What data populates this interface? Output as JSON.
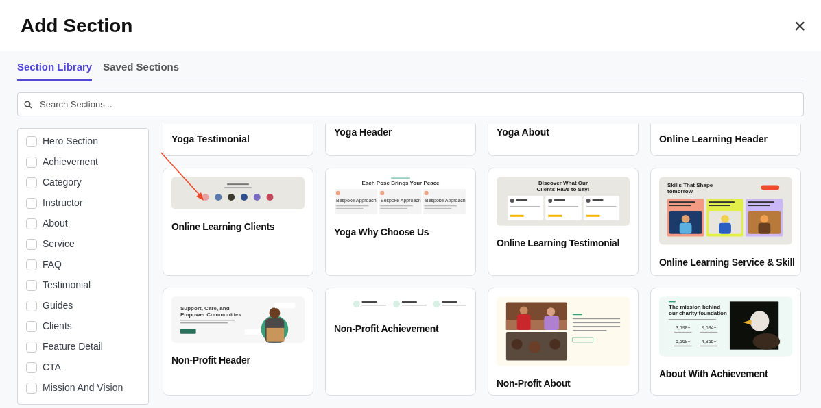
{
  "dialog": {
    "title": "Add Section",
    "close": "×"
  },
  "tabs": [
    {
      "label": "Section Library",
      "selected": true
    },
    {
      "label": "Saved Sections",
      "selected": false
    }
  ],
  "search": {
    "placeholder": "Search Sections..."
  },
  "filters": [
    {
      "label": "Hero Section",
      "checked": false
    },
    {
      "label": "Achievement",
      "checked": false
    },
    {
      "label": "Category",
      "checked": false
    },
    {
      "label": "Instructor",
      "checked": false
    },
    {
      "label": "About",
      "checked": false
    },
    {
      "label": "Service",
      "checked": false
    },
    {
      "label": "FAQ",
      "checked": false
    },
    {
      "label": "Testimonial",
      "checked": false
    },
    {
      "label": "Guides",
      "checked": false
    },
    {
      "label": "Clients",
      "checked": false
    },
    {
      "label": "Feature Detail",
      "checked": false
    },
    {
      "label": "CTA",
      "checked": false
    },
    {
      "label": "Mission And Vision",
      "checked": false
    }
  ],
  "partial_cards": [
    {
      "title": "Yoga Testimonial"
    },
    {
      "title": "Yoga Header"
    },
    {
      "title": "Yoga About"
    },
    {
      "title": "Online Learning Header"
    }
  ],
  "cards": [
    {
      "title": "Online Learning Clients",
      "thumbnail": {
        "kind": "clients"
      }
    },
    {
      "title": "Yoga Why Choose Us",
      "thumbnail": {
        "kind": "features",
        "heading": "Each Pose Brings Your Peace",
        "items": [
          "Bespoke Approach",
          "Bespoke Approach",
          "Bespoke Approach"
        ]
      }
    },
    {
      "title": "Online Learning Testimonial",
      "thumbnail": {
        "kind": "testimonial",
        "heading": "Discover What Our Clients Have to Say!"
      }
    },
    {
      "title": "Online Learning Service & Skill",
      "thumbnail": {
        "kind": "skills",
        "heading": "Skills That Shape tomorrow"
      }
    },
    {
      "title": "Non-Profit Header",
      "thumbnail": {
        "kind": "hero",
        "heading": "Support, Care, and Empower Communities"
      }
    },
    {
      "title": "Non-Profit Achievement",
      "thumbnail": {
        "kind": "achievement"
      }
    },
    {
      "title": "Non-Profit About",
      "thumbnail": {
        "kind": "photos"
      }
    },
    {
      "title": "About With Achievement",
      "thumbnail": {
        "kind": "mission",
        "heading": "The mission behind our charity foundation",
        "stats": [
          "3,598+",
          "9,634+",
          "5,568+",
          "4,856+"
        ]
      }
    }
  ]
}
